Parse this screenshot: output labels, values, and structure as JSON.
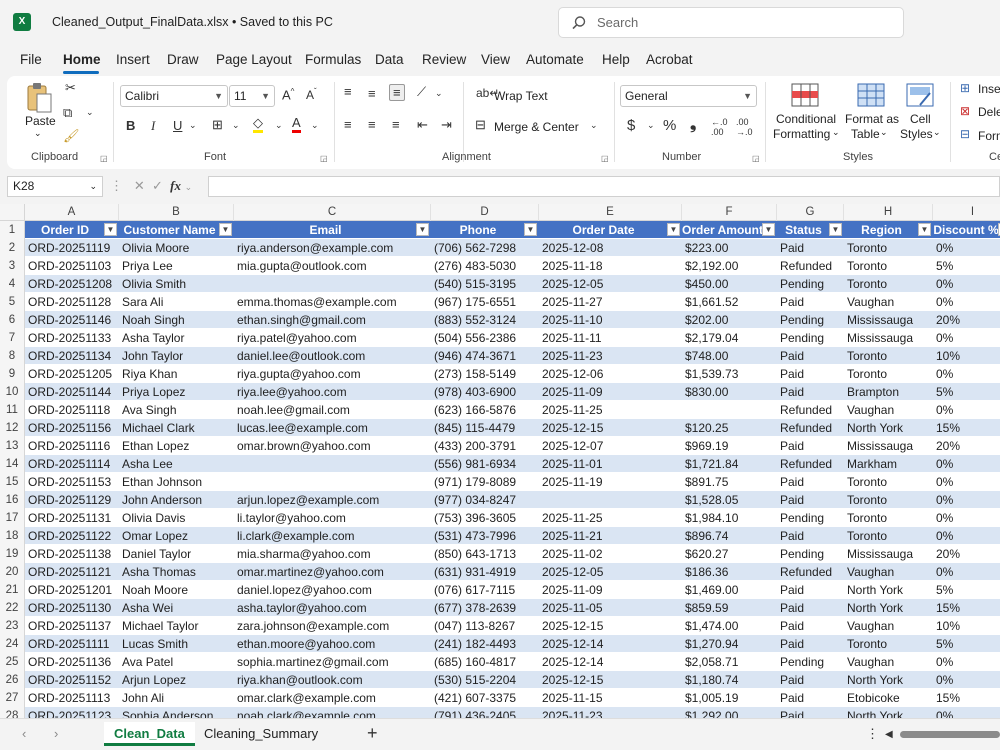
{
  "title_bar": {
    "app_icon": "excel-icon",
    "document_title": "Cleaned_Output_FinalData.xlsx • Saved to this PC",
    "search_placeholder": "Search"
  },
  "menu": [
    "File",
    "Home",
    "Insert",
    "Draw",
    "Page Layout",
    "Formulas",
    "Data",
    "Review",
    "View",
    "Automate",
    "Help",
    "Acrobat"
  ],
  "ribbon": {
    "clipboard": {
      "paste": "Paste",
      "group": "Clipboard"
    },
    "font": {
      "font_name": "Calibri",
      "font_size": "11",
      "group": "Font"
    },
    "alignment": {
      "wrap_text": "Wrap Text",
      "merge_center": "Merge & Center",
      "group": "Alignment"
    },
    "number": {
      "format": "General",
      "group": "Number"
    },
    "styles": {
      "conditional_1": "Conditional",
      "conditional_2": "Formatting",
      "format_table_1": "Format as",
      "format_table_2": "Table",
      "cell_styles_1": "Cell",
      "cell_styles_2": "Styles",
      "group": "Styles"
    },
    "cells": {
      "insert": "Inse",
      "delete": "Dele",
      "format": "Form",
      "group": "Ce"
    }
  },
  "formula_bar": {
    "name_box": "K28",
    "formula": ""
  },
  "columns": [
    "A",
    "B",
    "C",
    "D",
    "E",
    "F",
    "G",
    "H",
    "I"
  ],
  "headers": [
    "Order ID",
    "Customer Name",
    "Email",
    "Phone",
    "Order Date",
    "Order Amount",
    "Status",
    "Region",
    "Discount %"
  ],
  "rows": [
    [
      "ORD-20251119",
      "Olivia Moore",
      "riya.anderson@example.com",
      "(706) 562-7298",
      "2025-12-08",
      "$223.00",
      "Paid",
      "Toronto",
      "0%"
    ],
    [
      "ORD-20251103",
      "Priya Lee",
      "mia.gupta@outlook.com",
      "(276) 483-5030",
      "2025-11-18",
      "$2,192.00",
      "Refunded",
      "Toronto",
      "5%"
    ],
    [
      "ORD-20251208",
      "Olivia Smith",
      "",
      "(540) 515-3195",
      "2025-12-05",
      "$450.00",
      "Pending",
      "Toronto",
      "0%"
    ],
    [
      "ORD-20251128",
      "Sara Ali",
      "emma.thomas@example.com",
      "(967) 175-6551",
      "2025-11-27",
      "$1,661.52",
      "Paid",
      "Vaughan",
      "0%"
    ],
    [
      "ORD-20251146",
      "Noah Singh",
      "ethan.singh@gmail.com",
      "(883) 552-3124",
      "2025-11-10",
      "$202.00",
      "Pending",
      "Mississauga",
      "20%"
    ],
    [
      "ORD-20251133",
      "Asha Taylor",
      "riya.patel@yahoo.com",
      "(504) 556-2386",
      "2025-11-11",
      "$2,179.04",
      "Pending",
      "Mississauga",
      "0%"
    ],
    [
      "ORD-20251134",
      "John Taylor",
      "daniel.lee@outlook.com",
      "(946) 474-3671",
      "2025-11-23",
      "$748.00",
      "Paid",
      "Toronto",
      "10%"
    ],
    [
      "ORD-20251205",
      "Riya Khan",
      "riya.gupta@yahoo.com",
      "(273) 158-5149",
      "2025-12-06",
      "$1,539.73",
      "Paid",
      "Toronto",
      "0%"
    ],
    [
      "ORD-20251144",
      "Priya Lopez",
      "riya.lee@yahoo.com",
      "(978) 403-6900",
      "2025-11-09",
      "$830.00",
      "Paid",
      "Brampton",
      "5%"
    ],
    [
      "ORD-20251118",
      "Ava Singh",
      "noah.lee@gmail.com",
      "(623) 166-5876",
      "2025-11-25",
      "",
      "Refunded",
      "Vaughan",
      "0%"
    ],
    [
      "ORD-20251156",
      "Michael Clark",
      "lucas.lee@example.com",
      "(845) 115-4479",
      "2025-12-15",
      "$120.25",
      "Refunded",
      "North York",
      "15%"
    ],
    [
      "ORD-20251116",
      "Ethan Lopez",
      "omar.brown@yahoo.com",
      "(433) 200-3791",
      "2025-12-07",
      "$969.19",
      "Paid",
      "Mississauga",
      "20%"
    ],
    [
      "ORD-20251114",
      "Asha Lee",
      "",
      "(556) 981-6934",
      "2025-11-01",
      "$1,721.84",
      "Refunded",
      "Markham",
      "0%"
    ],
    [
      "ORD-20251153",
      "Ethan Johnson",
      "",
      "(971) 179-8089",
      "2025-11-19",
      "$891.75",
      "Paid",
      "Toronto",
      "0%"
    ],
    [
      "ORD-20251129",
      "John Anderson",
      "arjun.lopez@example.com",
      "(977) 034-8247",
      "",
      "$1,528.05",
      "Paid",
      "Toronto",
      "0%"
    ],
    [
      "ORD-20251131",
      "Olivia Davis",
      "li.taylor@yahoo.com",
      "(753) 396-3605",
      "2025-11-25",
      "$1,984.10",
      "Pending",
      "Toronto",
      "0%"
    ],
    [
      "ORD-20251122",
      "Omar Lopez",
      "li.clark@example.com",
      "(531) 473-7996",
      "2025-11-21",
      "$896.74",
      "Paid",
      "Toronto",
      "0%"
    ],
    [
      "ORD-20251138",
      "Daniel Taylor",
      "mia.sharma@yahoo.com",
      "(850) 643-1713",
      "2025-11-02",
      "$620.27",
      "Pending",
      "Mississauga",
      "20%"
    ],
    [
      "ORD-20251121",
      "Asha Thomas",
      "omar.martinez@yahoo.com",
      "(631) 931-4919",
      "2025-12-05",
      "$186.36",
      "Refunded",
      "Vaughan",
      "0%"
    ],
    [
      "ORD-20251201",
      "Noah Moore",
      "daniel.lopez@yahoo.com",
      "(076) 617-7115",
      "2025-11-09",
      "$1,469.00",
      "Paid",
      "North York",
      "5%"
    ],
    [
      "ORD-20251130",
      "Asha Wei",
      "asha.taylor@yahoo.com",
      "(677) 378-2639",
      "2025-11-05",
      "$859.59",
      "Paid",
      "North York",
      "15%"
    ],
    [
      "ORD-20251137",
      "Michael Taylor",
      "zara.johnson@example.com",
      "(047) 113-8267",
      "2025-12-15",
      "$1,474.00",
      "Paid",
      "Vaughan",
      "10%"
    ],
    [
      "ORD-20251111",
      "Lucas Smith",
      "ethan.moore@yahoo.com",
      "(241) 182-4493",
      "2025-12-14",
      "$1,270.94",
      "Paid",
      "Toronto",
      "5%"
    ],
    [
      "ORD-20251136",
      "Ava Patel",
      "sophia.martinez@gmail.com",
      "(685) 160-4817",
      "2025-12-14",
      "$2,058.71",
      "Pending",
      "Vaughan",
      "0%"
    ],
    [
      "ORD-20251152",
      "Arjun Lopez",
      "riya.khan@outlook.com",
      "(530) 515-2204",
      "2025-12-15",
      "$1,180.74",
      "Paid",
      "North York",
      "0%"
    ],
    [
      "ORD-20251113",
      "John Ali",
      "omar.clark@example.com",
      "(421) 607-3375",
      "2025-11-15",
      "$1,005.19",
      "Paid",
      "Etobicoke",
      "15%"
    ],
    [
      "ORD-20251123",
      "Sophia Anderson",
      "noah.clark@example.com",
      "(791) 436-2405",
      "2025-11-23",
      "$1,292.00",
      "Paid",
      "North York",
      "0%"
    ]
  ],
  "sheets": [
    "Clean_Data",
    "Cleaning_Summary"
  ],
  "colors": {
    "header_blue": "#4472c4",
    "band": "#dae5f3",
    "excel_green": "#107c41"
  }
}
